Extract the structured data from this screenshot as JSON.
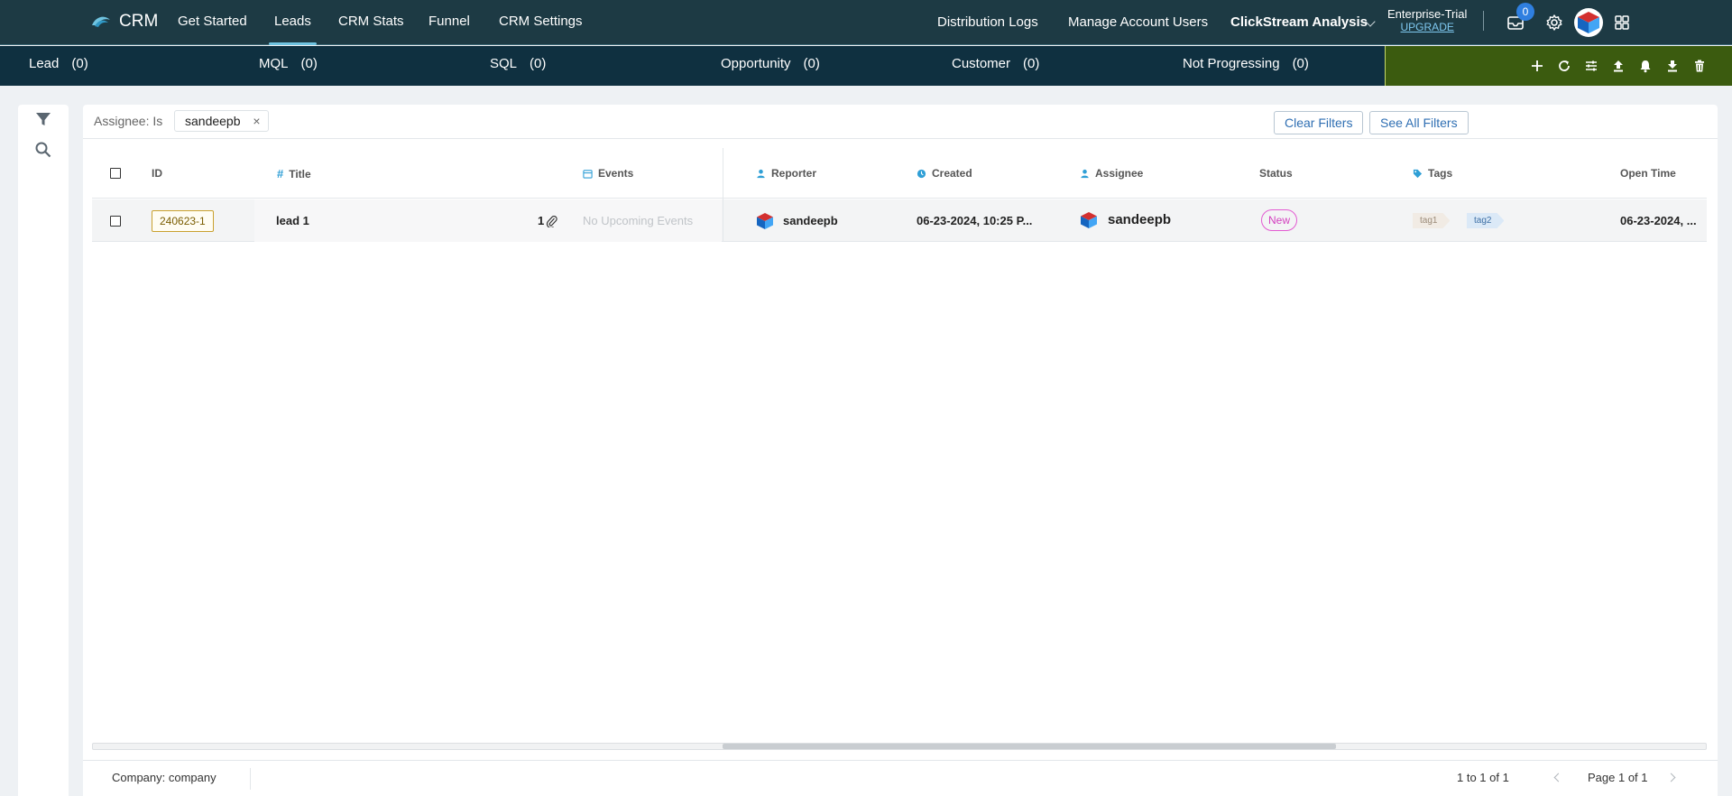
{
  "app": {
    "name": "CRM"
  },
  "nav": {
    "items": [
      {
        "label": "Get Started"
      },
      {
        "label": "Leads"
      },
      {
        "label": "CRM Stats"
      },
      {
        "label": "Funnel"
      },
      {
        "label": "CRM Settings"
      }
    ],
    "active": "Leads"
  },
  "topright": {
    "distribution_logs": "Distribution Logs",
    "manage_users": "Manage Account Users",
    "workspace": "ClickStream Analysis",
    "plan": "Enterprise-Trial",
    "upgrade": "UPGRADE",
    "inbox_count": "0"
  },
  "stages": [
    {
      "label": "Lead",
      "count": "(0)"
    },
    {
      "label": "MQL",
      "count": "(0)"
    },
    {
      "label": "SQL",
      "count": "(0)"
    },
    {
      "label": "Opportunity",
      "count": "(0)"
    },
    {
      "label": "Customer",
      "count": "(0)"
    },
    {
      "label": "Not Progressing",
      "count": "(0)"
    }
  ],
  "filters": {
    "label": "Assignee: Is",
    "chip": "sandeepb",
    "clear": "Clear Filters",
    "see_all": "See All Filters"
  },
  "table": {
    "columns": {
      "id": "ID",
      "title": "Title",
      "events": "Events",
      "reporter": "Reporter",
      "created": "Created",
      "assignee": "Assignee",
      "status": "Status",
      "tags": "Tags",
      "open_time": "Open Time"
    },
    "rows": [
      {
        "id": "240623-1",
        "title": "lead 1",
        "attachments": "1",
        "events": "No Upcoming Events",
        "reporter": "sandeepb",
        "created": "06-23-2024, 10:25 P...",
        "assignee": "sandeepb",
        "status": "New",
        "tags": [
          "tag1",
          "tag2"
        ],
        "open_time": "06-23-2024, ..."
      }
    ]
  },
  "footer": {
    "company": "Company: company",
    "count": "1 to 1 of 1",
    "page": "Page 1 of 1"
  },
  "colors": {
    "topnav": "#1d3a44",
    "stagebar": "#0f3040",
    "actionbar": "#3b5b0f",
    "accent_blue": "#2f7fe0",
    "status_new": "#d33fbf"
  },
  "icons": {
    "logo": "crm-logo-icon",
    "inbox": "inbox-icon",
    "settings": "gear-icon",
    "apps": "grid-icon",
    "actions": [
      "plus-icon",
      "refresh-icon",
      "sliders-icon",
      "upload-icon",
      "bell-icon",
      "download-icon",
      "trash-icon"
    ],
    "rail": [
      "filter-icon",
      "search-icon"
    ]
  }
}
